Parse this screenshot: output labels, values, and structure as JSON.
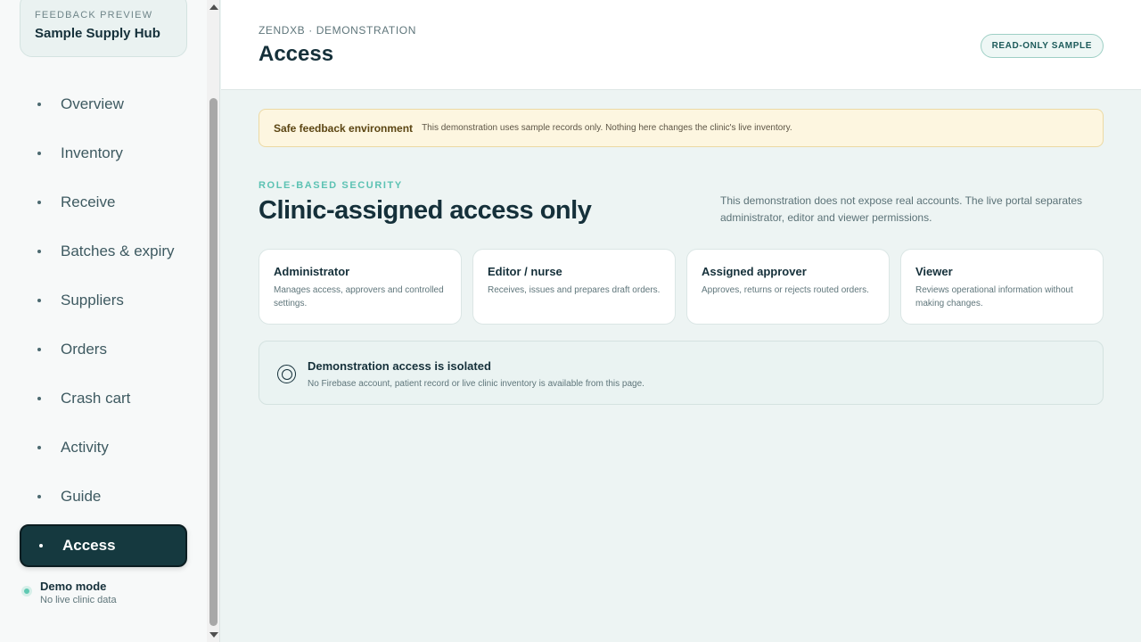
{
  "sidebar": {
    "brand": {
      "eyebrow": "FEEDBACK PREVIEW",
      "title": "Sample Supply Hub"
    },
    "items": [
      {
        "label": "Overview",
        "active": false
      },
      {
        "label": "Inventory",
        "active": false
      },
      {
        "label": "Receive",
        "active": false
      },
      {
        "label": "Batches & expiry",
        "active": false
      },
      {
        "label": "Suppliers",
        "active": false
      },
      {
        "label": "Orders",
        "active": false
      },
      {
        "label": "Crash cart",
        "active": false
      },
      {
        "label": "Activity",
        "active": false
      },
      {
        "label": "Guide",
        "active": false
      },
      {
        "label": "Access",
        "active": true
      }
    ],
    "demo": {
      "title": "Demo mode",
      "subtitle": "No live clinic data"
    }
  },
  "header": {
    "breadcrumb": "ZENDXB · DEMONSTRATION",
    "title": "Access",
    "badge": "READ-ONLY SAMPLE"
  },
  "notice": {
    "title": "Safe feedback environment",
    "text": "This demonstration uses sample records only. Nothing here changes the clinic's live inventory."
  },
  "section": {
    "eyebrow": "ROLE-BASED SECURITY",
    "title": "Clinic-assigned access only",
    "description": "This demonstration does not expose real accounts. The live portal separates administrator, editor and viewer permissions."
  },
  "roles": [
    {
      "title": "Administrator",
      "description": "Manages access, approvers and controlled settings."
    },
    {
      "title": "Editor / nurse",
      "description": "Receives, issues and prepares draft orders."
    },
    {
      "title": "Assigned approver",
      "description": "Approves, returns or rejects routed orders."
    },
    {
      "title": "Viewer",
      "description": "Reviews operational information without making changes."
    }
  ],
  "isolation": {
    "icon": "target-icon",
    "title": "Demonstration access is isolated",
    "text": "No Firebase account, patient record or live clinic inventory is available from this page."
  },
  "colors": {
    "accent": "#5cc2b3",
    "active_nav": "#15393f",
    "notice_bg": "#fdf6e0",
    "demo_dot": "#5fc9b2"
  }
}
